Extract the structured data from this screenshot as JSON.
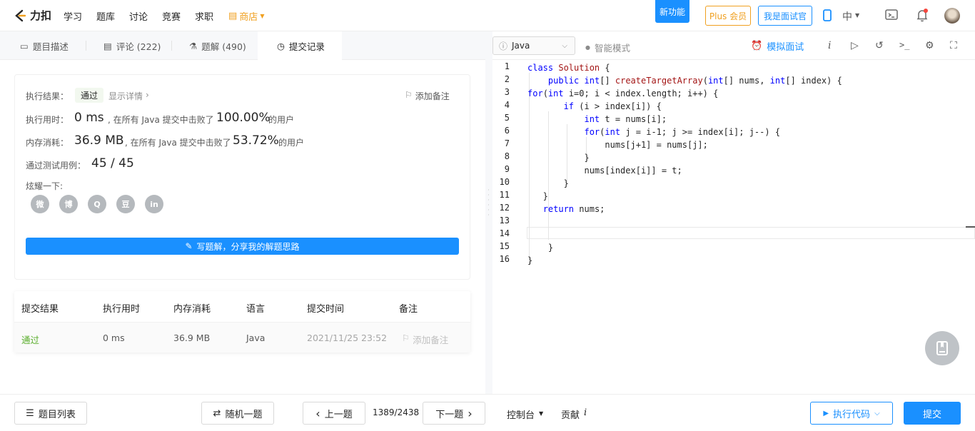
{
  "topbar": {
    "logo_text": "力扣",
    "nav": [
      "学习",
      "题库",
      "讨论",
      "竞赛",
      "求职"
    ],
    "shop": "商店",
    "new_feature": "新功能",
    "plus": "Plus 会员",
    "interviewer": "我是面试官",
    "lang": "中"
  },
  "tabs": [
    {
      "label": "题目描述"
    },
    {
      "label": "评论 (222)"
    },
    {
      "label": "题解 (490)"
    },
    {
      "label": "提交记录"
    }
  ],
  "result": {
    "label_result": "执行结果：",
    "status": "通过",
    "details": "显示详情",
    "add_note": "添加备注",
    "label_time": "执行用时：",
    "time_value": "0 ms",
    "time_desc": ", 在所有 Java 提交中击败了",
    "time_pct": "100.00%",
    "users": "的用户",
    "label_mem": "内存消耗：",
    "mem_value": "36.9 MB",
    "mem_desc": ", 在所有 Java 提交中击败了",
    "mem_pct": "53.72%",
    "label_tests": "通过测试用例：",
    "tests_value": "45 / 45",
    "share_label": "炫耀一下:",
    "share_icons": [
      "wechat-icon",
      "weibo-icon",
      "qq-icon",
      "douban-icon",
      "linkedin-icon"
    ],
    "share_glyphs": [
      "微",
      "博",
      "Q",
      "豆",
      "in"
    ],
    "write_solution": "写题解，分享我的解题思路"
  },
  "submissions": {
    "headers": [
      "提交结果",
      "执行用时",
      "内存消耗",
      "语言",
      "提交时间",
      "备注"
    ],
    "rows": [
      {
        "status": "通过",
        "time": "0 ms",
        "memory": "36.9 MB",
        "lang": "Java",
        "submitted": "2021/11/25 23:52",
        "note": "添加备注"
      }
    ]
  },
  "editor_toolbar": {
    "language": "Java",
    "smart_mode": "智能模式",
    "mock_interview": "模拟面试"
  },
  "code": {
    "lines": [
      "class Solution {",
      "    public int[] createTargetArray(int[] nums, int[] index) {",
      "for(int i=0; i < index.length; i++) {",
      "       if (i > index[i]) {",
      "           int t = nums[i];",
      "           for(int j = i-1; j >= index[i]; j--) {",
      "               nums[j+1] = nums[j];",
      "           }",
      "           nums[index[i]] = t;",
      "       }",
      "   }",
      "   return nums;",
      "",
      "",
      "    }",
      "}"
    ]
  },
  "bottombar": {
    "problem_list": "题目列表",
    "random": "随机一题",
    "prev": "上一题",
    "counter": "1389/2438",
    "next": "下一题",
    "console": "控制台",
    "contribute": "贡献",
    "run": "执行代码",
    "submit": "提交"
  },
  "colors": {
    "accent": "#1a90ff",
    "success": "#5aae2c",
    "plus": "#f0a020"
  }
}
